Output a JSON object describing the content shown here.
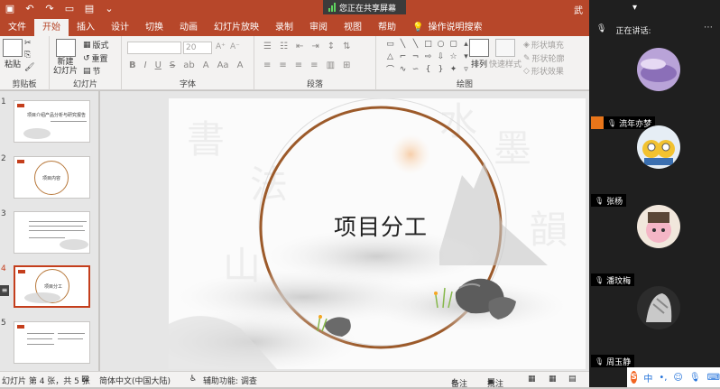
{
  "titlebar": {
    "share_banner": "您正在共享屏幕",
    "user_name": "武 芸杞"
  },
  "tabs": [
    {
      "label": "文件",
      "active": false
    },
    {
      "label": "开始",
      "active": true
    },
    {
      "label": "插入",
      "active": false
    },
    {
      "label": "设计",
      "active": false
    },
    {
      "label": "切换",
      "active": false
    },
    {
      "label": "动画",
      "active": false
    },
    {
      "label": "幻灯片放映",
      "active": false
    },
    {
      "label": "录制",
      "active": false
    },
    {
      "label": "审阅",
      "active": false
    },
    {
      "label": "视图",
      "active": false
    },
    {
      "label": "帮助",
      "active": false
    },
    {
      "label": "操作说明搜索",
      "active": false
    }
  ],
  "ribbon": {
    "clipboard": {
      "paste": "粘贴",
      "group": "剪贴板"
    },
    "slides": {
      "new_slide": "新建\n幻灯片",
      "layout": "版式",
      "reset": "重置",
      "section": "节",
      "group": "幻灯片"
    },
    "font": {
      "size_placeholder": "20",
      "group": "字体"
    },
    "paragraph": {
      "group": "段落"
    },
    "drawing": {
      "arrange": "排列",
      "quick_styles": "快速样式",
      "shape_fill": "形状填充",
      "shape_outline": "形状轮廓",
      "shape_effects": "形状效果",
      "group": "绘图"
    }
  },
  "thumbnails": [
    {
      "num": "1",
      "caption": "项目介绍产品分析与研究报告"
    },
    {
      "num": "2",
      "caption": "项目内容"
    },
    {
      "num": "3",
      "caption": ""
    },
    {
      "num": "4",
      "caption": "项目分工",
      "active": true
    },
    {
      "num": "5",
      "caption": ""
    }
  ],
  "slide": {
    "title": "项目分工"
  },
  "statusbar": {
    "slide_info": "幻灯片 第 4 张，共 5 张",
    "language": "简体中文(中国大陆)",
    "accessibility": "辅助功能: 调查",
    "notes": "备注",
    "comments": "批注"
  },
  "meeting": {
    "speaking_label": "正在讲话:",
    "participants": [
      {
        "name": "流年亦梦"
      },
      {
        "name": "张杨"
      },
      {
        "name": "潘玟梅"
      },
      {
        "name": "周玉静"
      }
    ]
  },
  "ime": {
    "label": "中"
  }
}
